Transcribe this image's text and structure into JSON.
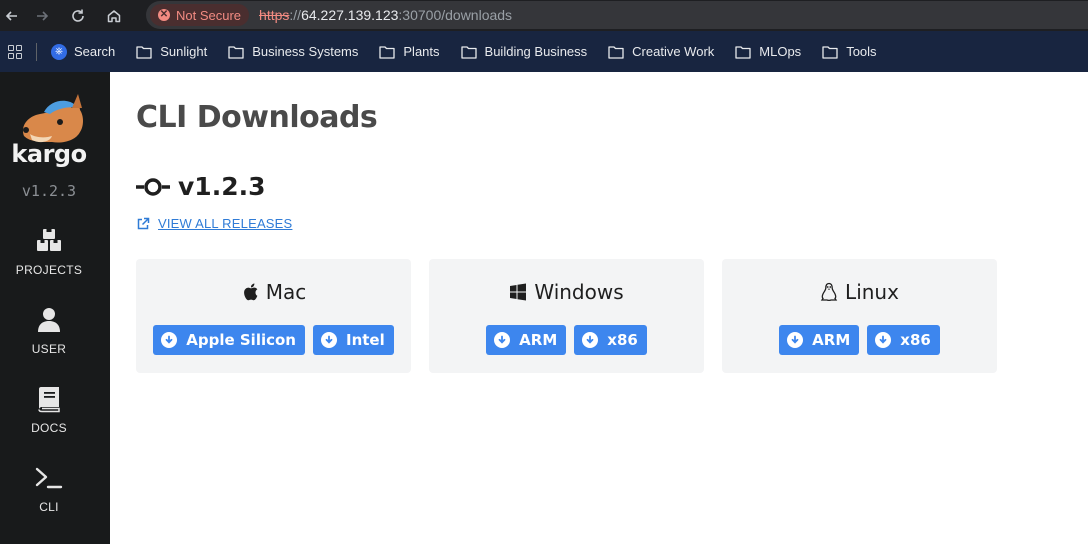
{
  "browser": {
    "security_label": "Not Secure",
    "url_scheme": "https",
    "url_sep": "://",
    "url_host": "64.227.139.123",
    "url_rest": ":30700/downloads"
  },
  "bookmarks": [
    {
      "label": "Search",
      "icon": "kubernetes-icon"
    },
    {
      "label": "Sunlight",
      "icon": "folder-icon"
    },
    {
      "label": "Business Systems",
      "icon": "folder-icon"
    },
    {
      "label": "Plants",
      "icon": "folder-icon"
    },
    {
      "label": "Building Business",
      "icon": "folder-icon"
    },
    {
      "label": "Creative Work",
      "icon": "folder-icon"
    },
    {
      "label": "MLOps",
      "icon": "folder-icon"
    },
    {
      "label": "Tools",
      "icon": "folder-icon"
    }
  ],
  "sidebar": {
    "brand": "kargo",
    "version": "v1.2.3",
    "items": [
      {
        "label": "PROJECTS",
        "icon": "boxes-icon"
      },
      {
        "label": "USER",
        "icon": "user-icon"
      },
      {
        "label": "DOCS",
        "icon": "book-icon"
      },
      {
        "label": "CLI",
        "icon": "terminal-icon"
      }
    ]
  },
  "main": {
    "title": "CLI Downloads",
    "version": "v1.2.3",
    "releases_link": "VIEW ALL RELEASES",
    "platforms": [
      {
        "name": "Mac",
        "icon": "apple-icon",
        "buttons": [
          "Apple Silicon",
          "Intel"
        ]
      },
      {
        "name": "Windows",
        "icon": "windows-icon",
        "buttons": [
          "ARM",
          "x86"
        ]
      },
      {
        "name": "Linux",
        "icon": "linux-icon",
        "buttons": [
          "ARM",
          "x86"
        ]
      }
    ]
  },
  "colors": {
    "accent": "#3d86ee",
    "sidebar_bg": "#181a1b",
    "card_bg": "#f3f4f5",
    "link": "#2f7bd6"
  }
}
